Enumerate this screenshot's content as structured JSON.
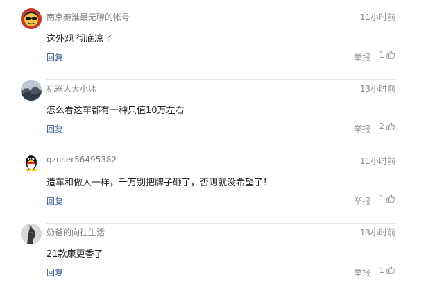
{
  "comments": [
    {
      "username": "南京秦淮最无聊的帐号",
      "time": "11小时前",
      "content": "这外观 彻底凉了",
      "reply_label": "回复",
      "report_label": "举报",
      "likes": "1",
      "avatar_icon": "sunglasses-face-avatar"
    },
    {
      "username": "机器人大小冰",
      "time": "13小时前",
      "content": "怎么看这车都有一种只值10万左右",
      "reply_label": "回复",
      "report_label": "举报",
      "likes": "2",
      "avatar_icon": "landscape-avatar"
    },
    {
      "username": "qzuser56495382",
      "time": "11小时前",
      "content": "造车和做人一样，千万别把牌子砸了，否则就没希望了！",
      "reply_label": "回复",
      "report_label": "举报",
      "likes": "1",
      "avatar_icon": "penguin-avatar"
    },
    {
      "username": "奶爸的向往生活",
      "time": "13小时前",
      "content": "21款康更香了",
      "reply_label": "回复",
      "report_label": "举报",
      "likes": "1",
      "avatar_icon": "horse-avatar"
    }
  ],
  "colors": {
    "username": "#7f7f7f",
    "reply_link": "#406599",
    "meta": "#999999",
    "divider": "#e6e6e6"
  }
}
